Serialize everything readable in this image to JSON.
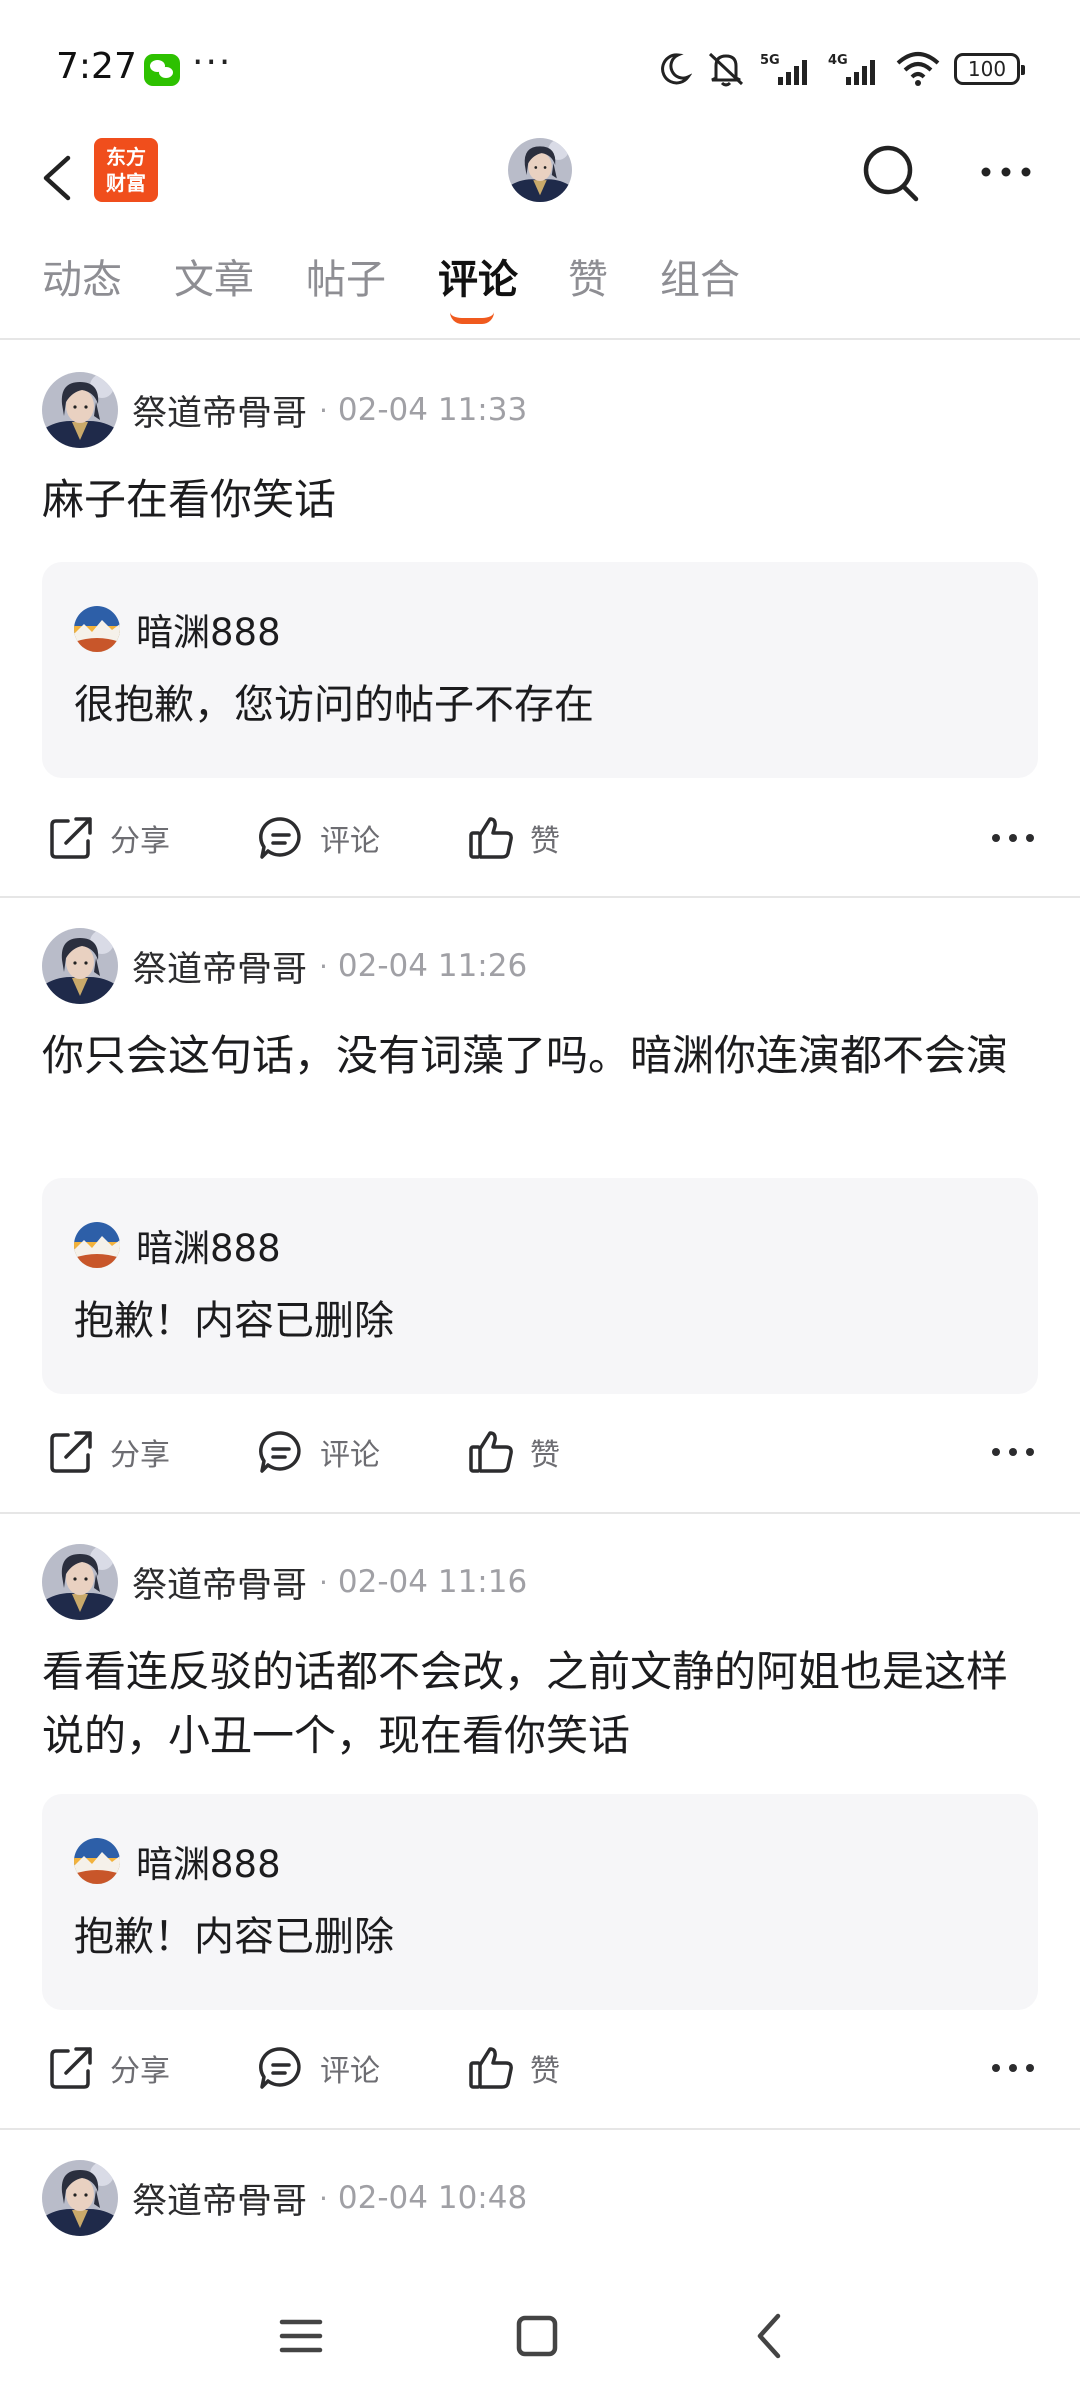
{
  "status_bar": {
    "time": "7:27",
    "battery": "100"
  },
  "header": {
    "logo_line1": "东方",
    "logo_line2": "财富"
  },
  "tabs": [
    {
      "label": "动态"
    },
    {
      "label": "文章"
    },
    {
      "label": "帖子"
    },
    {
      "label": "评论",
      "active": true
    },
    {
      "label": "赞"
    },
    {
      "label": "组合"
    }
  ],
  "actions": {
    "share": "分享",
    "comment": "评论",
    "like": "赞"
  },
  "posts": [
    {
      "author": "祭道帝骨哥",
      "time": "02-04 11:33",
      "text": "麻子在看你笑话",
      "quote": {
        "author": "暗渊888",
        "text": "很抱歉，您访问的帖子不存在"
      }
    },
    {
      "author": "祭道帝骨哥",
      "time": "02-04 11:26",
      "text": "你只会这句话，没有词藻了吗。暗渊你连演都不会演",
      "quote": {
        "author": "暗渊888",
        "text": "抱歉！内容已删除"
      }
    },
    {
      "author": "祭道帝骨哥",
      "time": "02-04 11:16",
      "text": "看看连反驳的话都不会改，之前文静的阿姐也是这样说的，小丑一个，现在看你笑话",
      "quote": {
        "author": "暗渊888",
        "text": "抱歉！内容已删除"
      }
    },
    {
      "author": "祭道帝骨哥",
      "time": "02-04 10:48"
    }
  ],
  "colors": {
    "accent": "#f05a1e",
    "logo": "#f04e1c",
    "quote_bg": "#f6f6f8"
  }
}
